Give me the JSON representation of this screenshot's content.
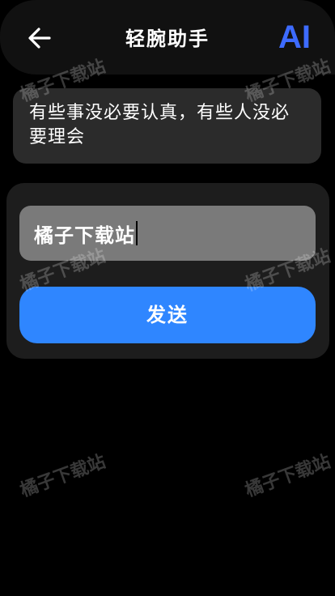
{
  "header": {
    "title": "轻腕助手",
    "back_icon": "arrow-left-icon",
    "ai_label": "AI",
    "ai_color": "#3d6bff"
  },
  "message": {
    "text": "有些事没必要认真，有些人没必要理会"
  },
  "input": {
    "value": "橘子下载站"
  },
  "send_button": {
    "label": "发送",
    "color": "#2f86ff"
  },
  "watermark": {
    "text": "橘子下载站"
  }
}
